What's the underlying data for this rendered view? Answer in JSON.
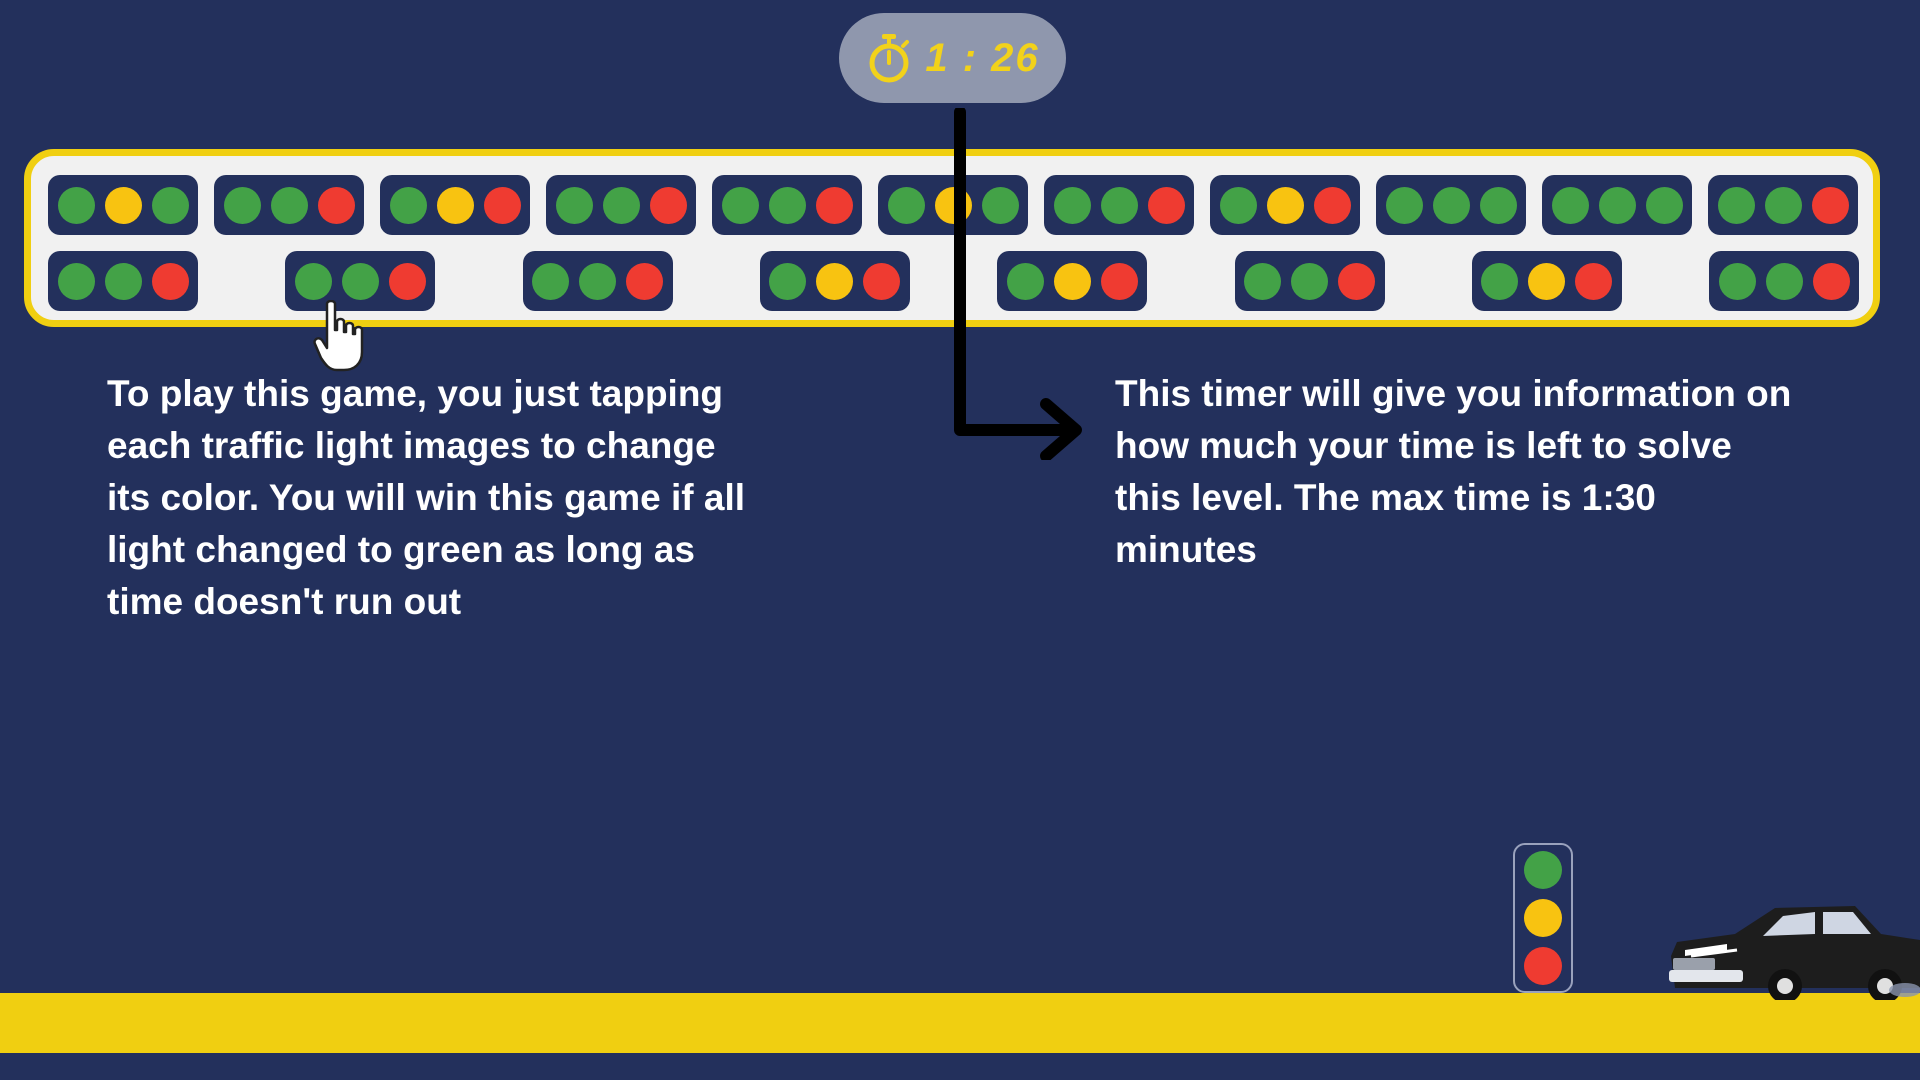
{
  "timer": {
    "icon": "stopwatch-icon",
    "text": "1 : 26"
  },
  "board": {
    "row1": [
      [
        "green",
        "yellow",
        "green"
      ],
      [
        "green",
        "green",
        "red"
      ],
      [
        "green",
        "yellow",
        "red"
      ],
      [
        "green",
        "green",
        "red"
      ],
      [
        "green",
        "green",
        "red"
      ],
      [
        "green",
        "yellow",
        "green"
      ],
      [
        "green",
        "green",
        "red"
      ],
      [
        "green",
        "yellow",
        "red"
      ],
      [
        "green",
        "green",
        "green"
      ],
      [
        "green",
        "green",
        "green"
      ],
      [
        "green",
        "green",
        "red"
      ]
    ],
    "row2": [
      [
        "green",
        "green",
        "red"
      ],
      [
        "green",
        "green",
        "red"
      ],
      [
        "green",
        "green",
        "red"
      ],
      [
        "green",
        "yellow",
        "red"
      ],
      [
        "green",
        "yellow",
        "red"
      ],
      [
        "green",
        "green",
        "red"
      ],
      [
        "green",
        "yellow",
        "red"
      ],
      [
        "green",
        "green",
        "red"
      ]
    ]
  },
  "instructions": {
    "left": "To play this game, you just tapping each traffic light images to change its color. You will win this game if all light changed to green as long as time doesn't run out",
    "right": "This timer will give you information on how much your time is left to solve this level. The max time is 1:30 minutes"
  },
  "side_light": [
    "green",
    "yellow",
    "red"
  ],
  "colors": {
    "background": "#23305c",
    "board": "#f1f1f1",
    "accent_yellow": "#f0cf11",
    "green": "#43a247",
    "yellow": "#f8c311",
    "red": "#ef3b31"
  }
}
